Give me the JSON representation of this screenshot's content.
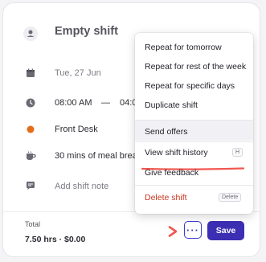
{
  "shift": {
    "title": "Empty shift",
    "date": "Tue, 27 Jun",
    "start_time": "08:00 AM",
    "time_dash": "—",
    "end_time_partial": "04:0",
    "location": "Front Desk",
    "break": "30 mins of meal brea",
    "note_placeholder": "Add shift note",
    "location_color": "#e46c1b"
  },
  "footer": {
    "total_label": "Total",
    "total_value": "7.50 hrs · $0.00",
    "more_label": "···",
    "save_label": "Save"
  },
  "menu": {
    "items": [
      {
        "label": "Repeat for tomorrow"
      },
      {
        "label": "Repeat for rest of the week"
      },
      {
        "label": "Repeat for specific days"
      },
      {
        "label": "Duplicate shift"
      },
      {
        "label": "Send offers"
      },
      {
        "label": "View shift history",
        "shortcut": "H"
      },
      {
        "label": "Give feedback"
      },
      {
        "label": "Delete shift",
        "shortcut": "Delete",
        "color": "#c8331f"
      }
    ]
  },
  "colors": {
    "accent": "#3d2fb3",
    "annotation": "#f0574f",
    "danger": "#c8331f"
  }
}
